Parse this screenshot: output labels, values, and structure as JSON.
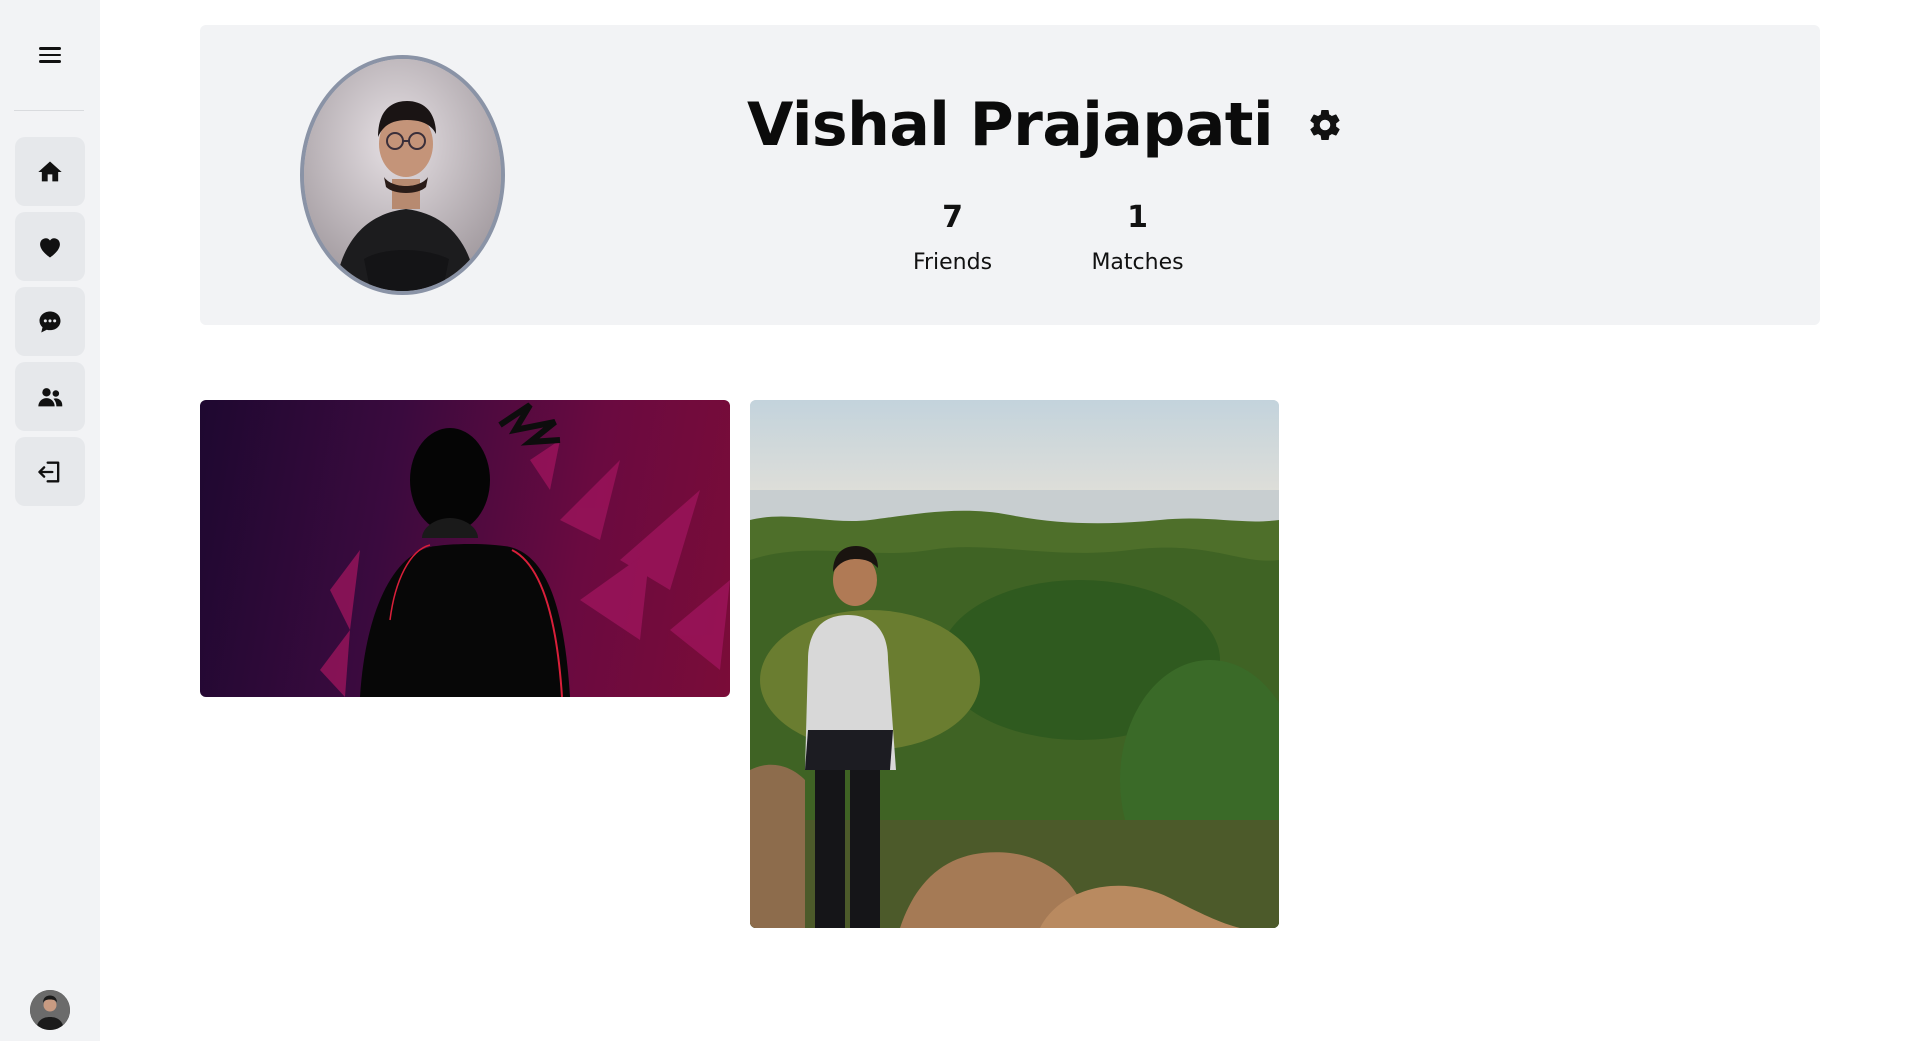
{
  "sidebar": {
    "items": [
      {
        "name": "home",
        "icon": "home-icon"
      },
      {
        "name": "likes",
        "icon": "heart-icon"
      },
      {
        "name": "messages",
        "icon": "chat-icon"
      },
      {
        "name": "friends",
        "icon": "users-icon"
      },
      {
        "name": "logout",
        "icon": "logout-icon"
      }
    ]
  },
  "profile": {
    "name": "Vishal Prajapati",
    "stats": [
      {
        "value": "7",
        "label": "Friends"
      },
      {
        "value": "1",
        "label": "Matches"
      }
    ]
  },
  "colors": {
    "sidebar_bg": "#f2f3f5",
    "nav_item_bg": "#e6e8eb",
    "card_bg": "#f2f3f5",
    "avatar_border": "#8a93a6"
  }
}
